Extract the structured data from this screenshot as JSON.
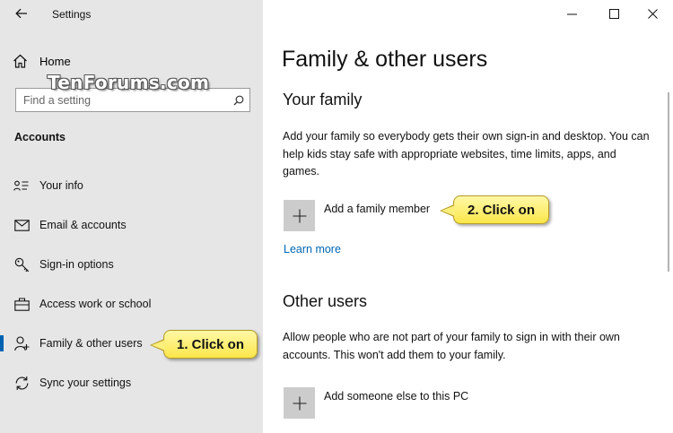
{
  "window": {
    "app_title": "Settings",
    "controls": [
      "minimize",
      "maximize",
      "close"
    ]
  },
  "watermark": "TenForums.com",
  "sidebar": {
    "home_label": "Home",
    "search": {
      "placeholder": "Find a setting"
    },
    "section_heading": "Accounts",
    "items": [
      {
        "label": "Your info",
        "icon": "contact-card-icon",
        "selected": false
      },
      {
        "label": "Email & accounts",
        "icon": "mail-icon",
        "selected": false
      },
      {
        "label": "Sign-in options",
        "icon": "key-icon",
        "selected": false
      },
      {
        "label": "Access work or school",
        "icon": "briefcase-icon",
        "selected": false
      },
      {
        "label": "Family & other users",
        "icon": "person-add-icon",
        "selected": true
      },
      {
        "label": "Sync your settings",
        "icon": "sync-icon",
        "selected": false
      }
    ]
  },
  "callouts": {
    "step1": "1. Click on",
    "step2": "2. Click on"
  },
  "main": {
    "title": "Family & other users",
    "your_family": {
      "heading": "Your family",
      "description": "Add your family so everybody gets their own sign-in and desktop. You can help kids stay safe with appropriate websites, time limits, apps, and games.",
      "add_label": "Add a family member",
      "learn_more": "Learn more"
    },
    "other_users": {
      "heading": "Other users",
      "description": "Allow people who are not part of your family to sign in with their own accounts. This won't add them to your family.",
      "add_label": "Add someone else to this PC"
    }
  },
  "colors": {
    "sidebar_bg": "#e6e6e6",
    "accent": "#0063b1",
    "link": "#0066b4",
    "callout": "#fbe64a",
    "plus_tile": "#cccccc"
  }
}
